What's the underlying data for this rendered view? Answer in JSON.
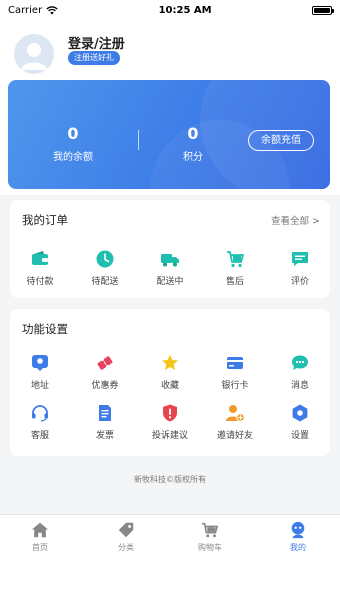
{
  "status_bar": {
    "carrier": "Carrier",
    "time": "10:25 AM"
  },
  "profile": {
    "name": "登录/注册",
    "badge": "注册送好礼"
  },
  "balance": {
    "amount_value": "0",
    "amount_label": "我的余额",
    "points_value": "0",
    "points_label": "积分",
    "recharge_label": "余额充值"
  },
  "orders": {
    "title": "我的订单",
    "view_all": "查看全部 >",
    "items": [
      {
        "label": "待付款",
        "icon": "wallet-icon"
      },
      {
        "label": "待配送",
        "icon": "clock-icon"
      },
      {
        "label": "配送中",
        "icon": "truck-icon"
      },
      {
        "label": "售后",
        "icon": "cart-return-icon"
      },
      {
        "label": "评价",
        "icon": "comment-icon"
      }
    ]
  },
  "features": {
    "title": "功能设置",
    "items": [
      {
        "label": "地址",
        "icon": "location-icon"
      },
      {
        "label": "优惠券",
        "icon": "coupon-icon"
      },
      {
        "label": "收藏",
        "icon": "star-icon"
      },
      {
        "label": "银行卡",
        "icon": "bank-card-icon"
      },
      {
        "label": "消息",
        "icon": "message-icon"
      },
      {
        "label": "客服",
        "icon": "headset-icon"
      },
      {
        "label": "发票",
        "icon": "invoice-icon"
      },
      {
        "label": "投诉建议",
        "icon": "complaint-icon"
      },
      {
        "label": "邀请好友",
        "icon": "invite-friend-icon"
      },
      {
        "label": "设置",
        "icon": "settings-icon"
      }
    ]
  },
  "copyright": "新牧科技©版权所有",
  "tabs": [
    {
      "label": "首页",
      "icon": "home-icon"
    },
    {
      "label": "分类",
      "icon": "tag-icon"
    },
    {
      "label": "购物车",
      "icon": "cart-icon"
    },
    {
      "label": "我的",
      "icon": "profile-icon",
      "active": true
    }
  ],
  "colors": {
    "accent": "#3d7be6",
    "teal": "#1fbfb0",
    "red": "#e8444f",
    "yellow": "#f5c518"
  }
}
